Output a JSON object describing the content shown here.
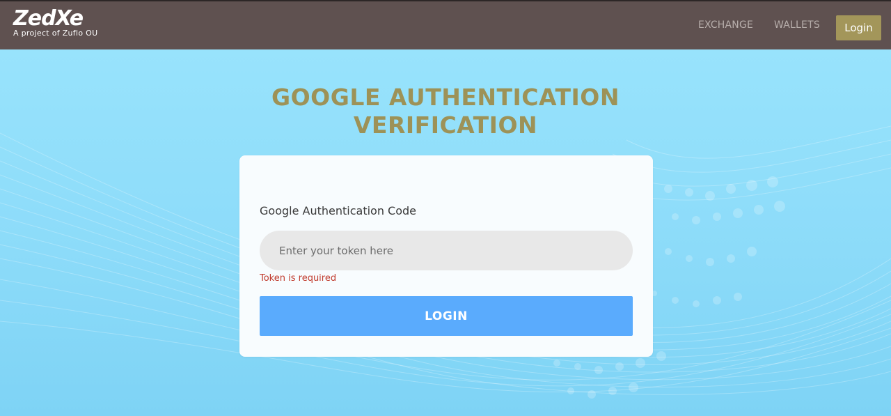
{
  "header": {
    "logo_text": "ZedXe",
    "logo_subtitle": "A project of Zuflo OU",
    "nav": {
      "exchange": "EXCHANGE",
      "wallets": "WALLETS",
      "login": "Login"
    }
  },
  "main": {
    "title": "GOOGLE AUTHENTICATION VERIFICATION",
    "form": {
      "label": "Google Authentication Code",
      "token_placeholder": "Enter your token here",
      "token_value": "",
      "error": "Token is required",
      "submit_label": "LOGIN"
    }
  },
  "colors": {
    "header_bg": "#5f5150",
    "page_bg": "#96e0fb",
    "title": "#9d9257",
    "header_login_btn": "#a3965a",
    "submit_btn": "#5aabfd",
    "error": "#c0392b"
  }
}
